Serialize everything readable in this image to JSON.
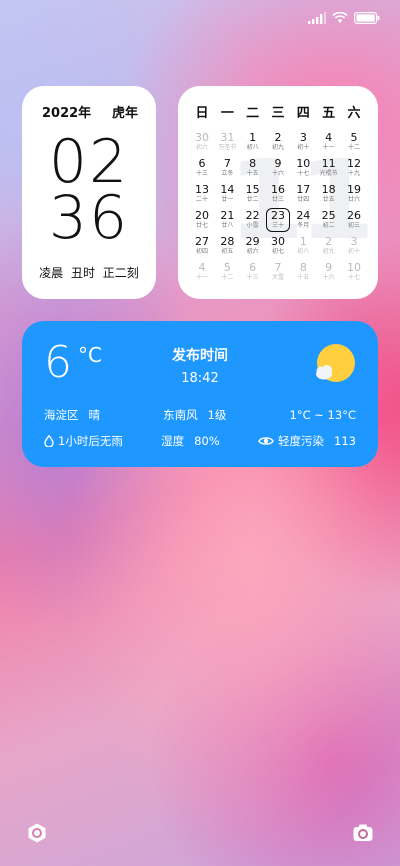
{
  "status": {
    "signal": "signal-icon",
    "wifi": "wifi-icon",
    "battery": "battery-icon"
  },
  "clock": {
    "year": "2022年",
    "zodiac": "虎年",
    "hour": "02",
    "minute": "36",
    "lunar": "凌晨 丑时 正二刻"
  },
  "calendar": {
    "watermark": "11",
    "weekdays": [
      "日",
      "一",
      "二",
      "三",
      "四",
      "五",
      "六"
    ],
    "weeks": [
      [
        [
          "30",
          "初六",
          1
        ],
        [
          "31",
          "万圣节",
          1
        ],
        [
          "1",
          "初八",
          0
        ],
        [
          "2",
          "初九",
          0
        ],
        [
          "3",
          "初十",
          0
        ],
        [
          "4",
          "十一",
          0
        ],
        [
          "5",
          "十二",
          0
        ]
      ],
      [
        [
          "6",
          "十三",
          0
        ],
        [
          "7",
          "立冬",
          0
        ],
        [
          "8",
          "十五",
          0
        ],
        [
          "9",
          "十六",
          0
        ],
        [
          "10",
          "十七",
          0
        ],
        [
          "11",
          "光棍节",
          0
        ],
        [
          "12",
          "十九",
          0
        ]
      ],
      [
        [
          "13",
          "二十",
          0
        ],
        [
          "14",
          "廿一",
          0
        ],
        [
          "15",
          "廿二",
          0
        ],
        [
          "16",
          "廿三",
          0
        ],
        [
          "17",
          "廿四",
          0
        ],
        [
          "18",
          "廿五",
          0
        ],
        [
          "19",
          "廿六",
          0
        ]
      ],
      [
        [
          "20",
          "廿七",
          0
        ],
        [
          "21",
          "廿八",
          0
        ],
        [
          "22",
          "小雪",
          0
        ],
        [
          "23",
          "三十",
          0
        ],
        [
          "24",
          "冬月",
          0
        ],
        [
          "25",
          "初二",
          0
        ],
        [
          "26",
          "初三",
          0
        ]
      ],
      [
        [
          "27",
          "初四",
          0
        ],
        [
          "28",
          "初五",
          0
        ],
        [
          "29",
          "初六",
          0
        ],
        [
          "30",
          "初七",
          0
        ],
        [
          "1",
          "初八",
          1
        ],
        [
          "2",
          "初九",
          1
        ],
        [
          "3",
          "初十",
          1
        ]
      ],
      [
        [
          "4",
          "十一",
          1
        ],
        [
          "5",
          "十二",
          1
        ],
        [
          "6",
          "十三",
          1
        ],
        [
          "7",
          "大雪",
          1
        ],
        [
          "8",
          "十五",
          1
        ],
        [
          "9",
          "十六",
          1
        ],
        [
          "10",
          "十七",
          1
        ]
      ]
    ],
    "today": "23"
  },
  "weather": {
    "temp": "6",
    "unit": "°C",
    "publish_title": "发布时间",
    "publish_time": "18:42",
    "location": "海淀区",
    "condition": "晴",
    "wind": "东南风",
    "wind_level": "1级",
    "range": "1°C ~ 13°C",
    "rain": "1小时后无雨",
    "humidity_label": "湿度",
    "humidity": "80%",
    "aqi_label": "轻度污染",
    "aqi": "113",
    "bg_color": "#1e98ff",
    "sun_color": "#ffcf3f"
  },
  "dock": {
    "left_icon": "shutter-icon",
    "right_icon": "camera-icon"
  }
}
